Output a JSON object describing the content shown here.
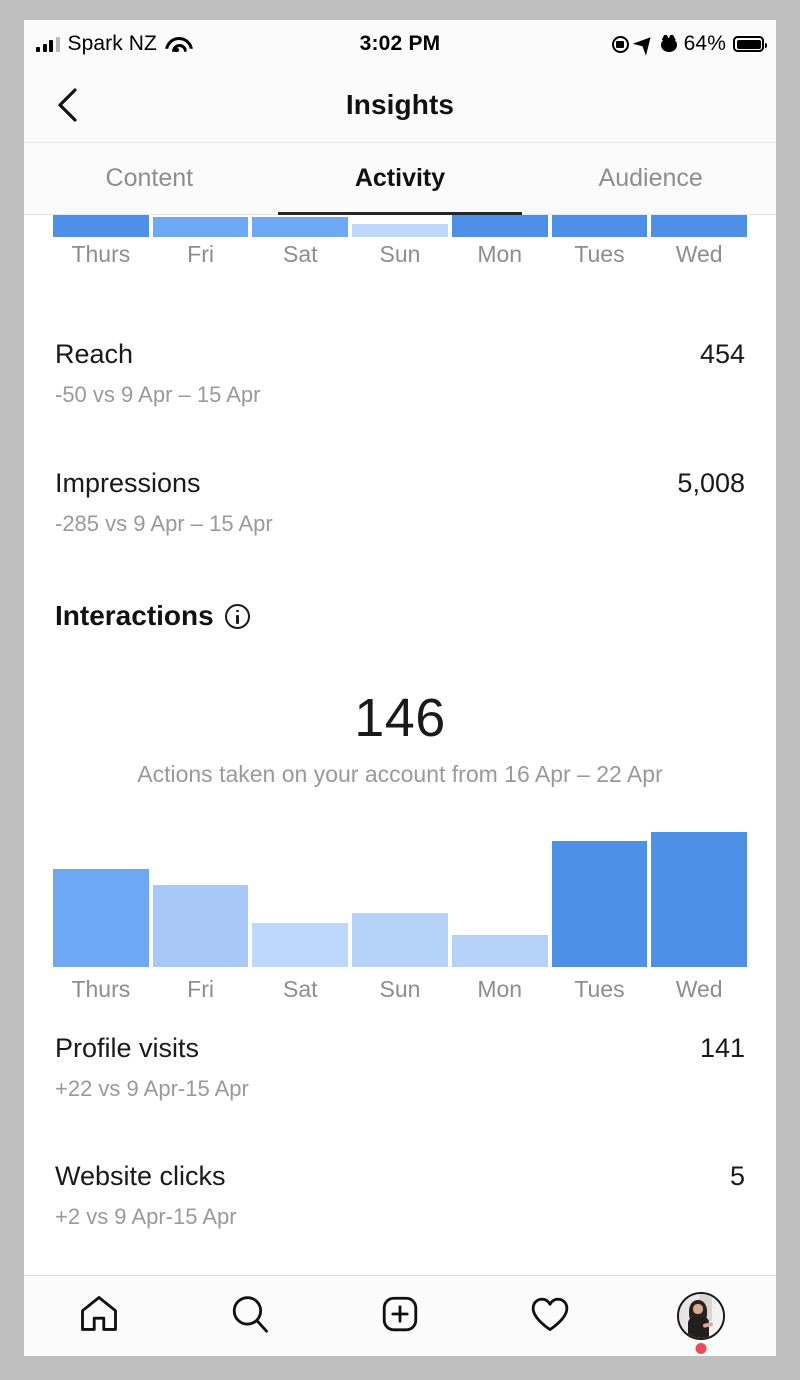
{
  "status_bar": {
    "carrier": "Spark NZ",
    "time": "3:02 PM",
    "battery_percent": "64%",
    "icons": [
      "signal-bars-icon",
      "wifi-icon",
      "rotation-lock-icon",
      "location-arrow-icon",
      "alarm-clock-icon",
      "battery-icon"
    ]
  },
  "header": {
    "title": "Insights",
    "back_label": "back-chevron-icon"
  },
  "tabs": [
    {
      "label": "Content",
      "active": false
    },
    {
      "label": "Activity",
      "active": true
    },
    {
      "label": "Audience",
      "active": false
    }
  ],
  "metrics": [
    {
      "label": "Reach",
      "value": "454",
      "sub": "-50 vs 9 Apr – 15 Apr"
    },
    {
      "label": "Impressions",
      "value": "5,008",
      "sub": "-285 vs 9 Apr – 15 Apr"
    },
    {
      "label": "Profile visits",
      "value": "141",
      "sub": "+22 vs 9 Apr-15 Apr"
    },
    {
      "label": "Website clicks",
      "value": "5",
      "sub": "+2 vs 9 Apr-15 Apr"
    }
  ],
  "interactions": {
    "title": "Interactions",
    "info_icon": "info-circle-icon",
    "total": "146",
    "subtitle": "Actions taken on your account from 16 Apr – 22 Apr"
  },
  "bottom_nav": [
    {
      "name": "home-icon",
      "label": "Home"
    },
    {
      "name": "search-icon",
      "label": "Search"
    },
    {
      "name": "add-post-icon",
      "label": "New post"
    },
    {
      "name": "heart-icon",
      "label": "Activity"
    },
    {
      "name": "profile-avatar",
      "label": "Profile"
    }
  ],
  "colors": {
    "bar_dark": "#4e8fe8",
    "bar_medium": "#6fa8f5",
    "bar_light": "#a8c9f7",
    "bar_lightest": "#bcd8fa",
    "accent_text": "#262626",
    "muted_text": "#8e8e8e",
    "notification_dot": "#ed4956"
  },
  "chart_data": [
    {
      "type": "bar",
      "title": "Impressions (cut off at top of viewport)",
      "categories": [
        "Thurs",
        "Fri",
        "Sat",
        "Sun",
        "Mon",
        "Tues",
        "Wed"
      ],
      "values": [
        22,
        20,
        20,
        13,
        22,
        22,
        22
      ],
      "colors": [
        "#4e8fe8",
        "#6fa8f5",
        "#6fa8f5",
        "#bcd8fa",
        "#4e8fe8",
        "#4e8fe8",
        "#4e8fe8"
      ],
      "xlabel": "",
      "ylabel": "",
      "ylim": [
        0,
        22
      ],
      "grid": false,
      "legend": false,
      "note": "Only the bottom 22px of these bars are visible; chart is scrolled off-screen"
    },
    {
      "type": "bar",
      "title": "Interactions",
      "subtitle": "Actions taken on your account from 16 Apr – 22 Apr",
      "total": 146,
      "categories": [
        "Thurs",
        "Fri",
        "Sat",
        "Sun",
        "Mon",
        "Tues",
        "Wed"
      ],
      "values": [
        92,
        77,
        41,
        51,
        30,
        119,
        127
      ],
      "colors": [
        "#6fa8f5",
        "#a8c9f7",
        "#bcd8fa",
        "#b5d2f9",
        "#b5d2f9",
        "#4e8fe8",
        "#4e8fe8"
      ],
      "xlabel": "",
      "ylabel": "",
      "ylim": [
        0,
        127
      ],
      "grid": false,
      "legend": false
    }
  ]
}
